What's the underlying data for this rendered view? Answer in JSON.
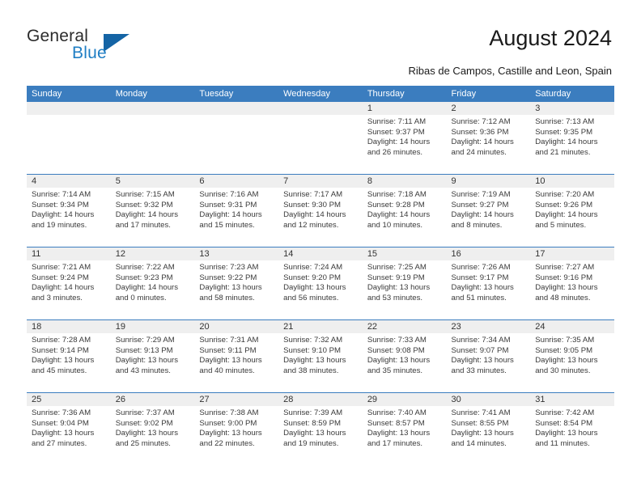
{
  "brand": {
    "name_part1": "General",
    "name_part2": "Blue",
    "triangle_icon": "triangle-icon",
    "accent_color": "#1f7ec4",
    "triangle_color": "#1464a5"
  },
  "header": {
    "title": "August 2024",
    "subtitle": "Ribas de Campos, Castille and Leon, Spain"
  },
  "calendar": {
    "header_bg": "#3b7dbf",
    "daynum_bg": "#efefef",
    "weekdays": [
      "Sunday",
      "Monday",
      "Tuesday",
      "Wednesday",
      "Thursday",
      "Friday",
      "Saturday"
    ],
    "weeks": [
      [
        {
          "day": "",
          "sunrise": "",
          "sunset": "",
          "daylight_line1": "",
          "daylight_line2": ""
        },
        {
          "day": "",
          "sunrise": "",
          "sunset": "",
          "daylight_line1": "",
          "daylight_line2": ""
        },
        {
          "day": "",
          "sunrise": "",
          "sunset": "",
          "daylight_line1": "",
          "daylight_line2": ""
        },
        {
          "day": "",
          "sunrise": "",
          "sunset": "",
          "daylight_line1": "",
          "daylight_line2": ""
        },
        {
          "day": "1",
          "sunrise": "Sunrise: 7:11 AM",
          "sunset": "Sunset: 9:37 PM",
          "daylight_line1": "Daylight: 14 hours",
          "daylight_line2": "and 26 minutes."
        },
        {
          "day": "2",
          "sunrise": "Sunrise: 7:12 AM",
          "sunset": "Sunset: 9:36 PM",
          "daylight_line1": "Daylight: 14 hours",
          "daylight_line2": "and 24 minutes."
        },
        {
          "day": "3",
          "sunrise": "Sunrise: 7:13 AM",
          "sunset": "Sunset: 9:35 PM",
          "daylight_line1": "Daylight: 14 hours",
          "daylight_line2": "and 21 minutes."
        }
      ],
      [
        {
          "day": "4",
          "sunrise": "Sunrise: 7:14 AM",
          "sunset": "Sunset: 9:34 PM",
          "daylight_line1": "Daylight: 14 hours",
          "daylight_line2": "and 19 minutes."
        },
        {
          "day": "5",
          "sunrise": "Sunrise: 7:15 AM",
          "sunset": "Sunset: 9:32 PM",
          "daylight_line1": "Daylight: 14 hours",
          "daylight_line2": "and 17 minutes."
        },
        {
          "day": "6",
          "sunrise": "Sunrise: 7:16 AM",
          "sunset": "Sunset: 9:31 PM",
          "daylight_line1": "Daylight: 14 hours",
          "daylight_line2": "and 15 minutes."
        },
        {
          "day": "7",
          "sunrise": "Sunrise: 7:17 AM",
          "sunset": "Sunset: 9:30 PM",
          "daylight_line1": "Daylight: 14 hours",
          "daylight_line2": "and 12 minutes."
        },
        {
          "day": "8",
          "sunrise": "Sunrise: 7:18 AM",
          "sunset": "Sunset: 9:28 PM",
          "daylight_line1": "Daylight: 14 hours",
          "daylight_line2": "and 10 minutes."
        },
        {
          "day": "9",
          "sunrise": "Sunrise: 7:19 AM",
          "sunset": "Sunset: 9:27 PM",
          "daylight_line1": "Daylight: 14 hours",
          "daylight_line2": "and 8 minutes."
        },
        {
          "day": "10",
          "sunrise": "Sunrise: 7:20 AM",
          "sunset": "Sunset: 9:26 PM",
          "daylight_line1": "Daylight: 14 hours",
          "daylight_line2": "and 5 minutes."
        }
      ],
      [
        {
          "day": "11",
          "sunrise": "Sunrise: 7:21 AM",
          "sunset": "Sunset: 9:24 PM",
          "daylight_line1": "Daylight: 14 hours",
          "daylight_line2": "and 3 minutes."
        },
        {
          "day": "12",
          "sunrise": "Sunrise: 7:22 AM",
          "sunset": "Sunset: 9:23 PM",
          "daylight_line1": "Daylight: 14 hours",
          "daylight_line2": "and 0 minutes."
        },
        {
          "day": "13",
          "sunrise": "Sunrise: 7:23 AM",
          "sunset": "Sunset: 9:22 PM",
          "daylight_line1": "Daylight: 13 hours",
          "daylight_line2": "and 58 minutes."
        },
        {
          "day": "14",
          "sunrise": "Sunrise: 7:24 AM",
          "sunset": "Sunset: 9:20 PM",
          "daylight_line1": "Daylight: 13 hours",
          "daylight_line2": "and 56 minutes."
        },
        {
          "day": "15",
          "sunrise": "Sunrise: 7:25 AM",
          "sunset": "Sunset: 9:19 PM",
          "daylight_line1": "Daylight: 13 hours",
          "daylight_line2": "and 53 minutes."
        },
        {
          "day": "16",
          "sunrise": "Sunrise: 7:26 AM",
          "sunset": "Sunset: 9:17 PM",
          "daylight_line1": "Daylight: 13 hours",
          "daylight_line2": "and 51 minutes."
        },
        {
          "day": "17",
          "sunrise": "Sunrise: 7:27 AM",
          "sunset": "Sunset: 9:16 PM",
          "daylight_line1": "Daylight: 13 hours",
          "daylight_line2": "and 48 minutes."
        }
      ],
      [
        {
          "day": "18",
          "sunrise": "Sunrise: 7:28 AM",
          "sunset": "Sunset: 9:14 PM",
          "daylight_line1": "Daylight: 13 hours",
          "daylight_line2": "and 45 minutes."
        },
        {
          "day": "19",
          "sunrise": "Sunrise: 7:29 AM",
          "sunset": "Sunset: 9:13 PM",
          "daylight_line1": "Daylight: 13 hours",
          "daylight_line2": "and 43 minutes."
        },
        {
          "day": "20",
          "sunrise": "Sunrise: 7:31 AM",
          "sunset": "Sunset: 9:11 PM",
          "daylight_line1": "Daylight: 13 hours",
          "daylight_line2": "and 40 minutes."
        },
        {
          "day": "21",
          "sunrise": "Sunrise: 7:32 AM",
          "sunset": "Sunset: 9:10 PM",
          "daylight_line1": "Daylight: 13 hours",
          "daylight_line2": "and 38 minutes."
        },
        {
          "day": "22",
          "sunrise": "Sunrise: 7:33 AM",
          "sunset": "Sunset: 9:08 PM",
          "daylight_line1": "Daylight: 13 hours",
          "daylight_line2": "and 35 minutes."
        },
        {
          "day": "23",
          "sunrise": "Sunrise: 7:34 AM",
          "sunset": "Sunset: 9:07 PM",
          "daylight_line1": "Daylight: 13 hours",
          "daylight_line2": "and 33 minutes."
        },
        {
          "day": "24",
          "sunrise": "Sunrise: 7:35 AM",
          "sunset": "Sunset: 9:05 PM",
          "daylight_line1": "Daylight: 13 hours",
          "daylight_line2": "and 30 minutes."
        }
      ],
      [
        {
          "day": "25",
          "sunrise": "Sunrise: 7:36 AM",
          "sunset": "Sunset: 9:04 PM",
          "daylight_line1": "Daylight: 13 hours",
          "daylight_line2": "and 27 minutes."
        },
        {
          "day": "26",
          "sunrise": "Sunrise: 7:37 AM",
          "sunset": "Sunset: 9:02 PM",
          "daylight_line1": "Daylight: 13 hours",
          "daylight_line2": "and 25 minutes."
        },
        {
          "day": "27",
          "sunrise": "Sunrise: 7:38 AM",
          "sunset": "Sunset: 9:00 PM",
          "daylight_line1": "Daylight: 13 hours",
          "daylight_line2": "and 22 minutes."
        },
        {
          "day": "28",
          "sunrise": "Sunrise: 7:39 AM",
          "sunset": "Sunset: 8:59 PM",
          "daylight_line1": "Daylight: 13 hours",
          "daylight_line2": "and 19 minutes."
        },
        {
          "day": "29",
          "sunrise": "Sunrise: 7:40 AM",
          "sunset": "Sunset: 8:57 PM",
          "daylight_line1": "Daylight: 13 hours",
          "daylight_line2": "and 17 minutes."
        },
        {
          "day": "30",
          "sunrise": "Sunrise: 7:41 AM",
          "sunset": "Sunset: 8:55 PM",
          "daylight_line1": "Daylight: 13 hours",
          "daylight_line2": "and 14 minutes."
        },
        {
          "day": "31",
          "sunrise": "Sunrise: 7:42 AM",
          "sunset": "Sunset: 8:54 PM",
          "daylight_line1": "Daylight: 13 hours",
          "daylight_line2": "and 11 minutes."
        }
      ]
    ]
  }
}
